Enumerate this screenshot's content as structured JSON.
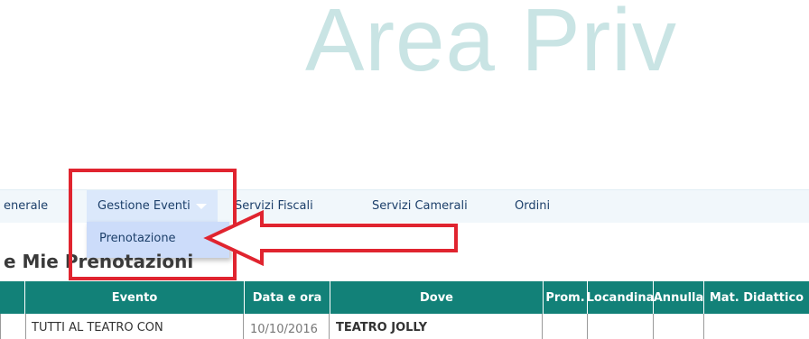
{
  "header": {
    "title": "Area Priv"
  },
  "nav": {
    "items": [
      {
        "label": "enerale"
      },
      {
        "label": "Gestione Eventi"
      },
      {
        "label": "Servizi Fiscali"
      },
      {
        "label": "Servizi Camerali"
      },
      {
        "label": "Ordini"
      }
    ],
    "dropdown": {
      "items": [
        {
          "label": "Prenotazione"
        }
      ]
    }
  },
  "page": {
    "heading": "e Mie Prenotazioni"
  },
  "table": {
    "columns": [
      {
        "label": ""
      },
      {
        "label": "Evento"
      },
      {
        "label": "Data e ora"
      },
      {
        "label": "Dove"
      },
      {
        "label": "Prom."
      },
      {
        "label": "Locandina"
      },
      {
        "label": "Annulla"
      },
      {
        "label": "Mat. Didattico"
      }
    ],
    "rows": [
      {
        "evento": "TUTTI AL TEATRO CON",
        "data": "10/10/2016",
        "dove": "TEATRO JOLLY"
      }
    ]
  },
  "colors": {
    "header_bg": "#128178",
    "highlight": "#e0242f",
    "title": "#c9e4e4",
    "dropdown_bg": "#ccdcfa"
  },
  "icons": [
    "caret-down-icon",
    "red-arrow-annotation"
  ]
}
